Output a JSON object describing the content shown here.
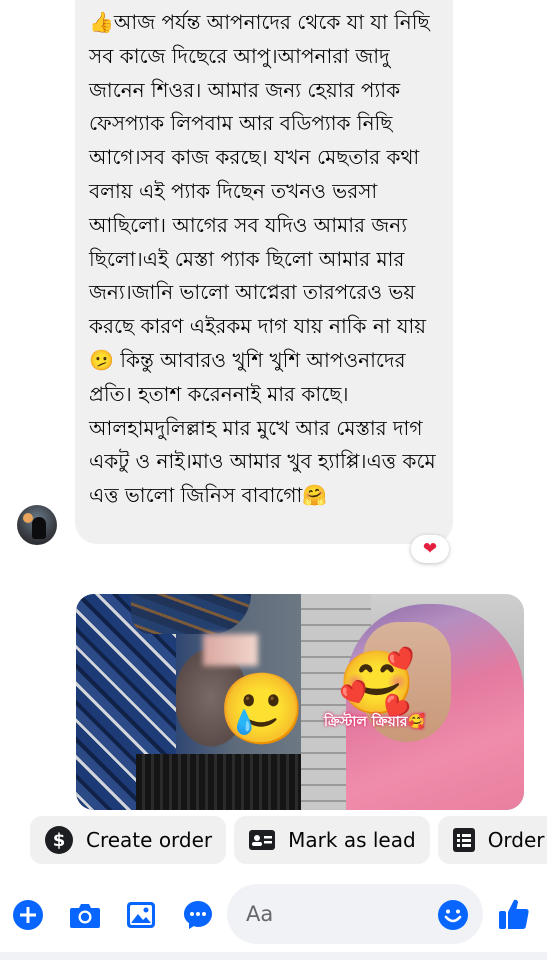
{
  "message": {
    "text": "👍আজ পর্যন্ত আপনাদের থেকে যা যা নিছি সব কাজে দিছেরে আপু।আপনারা জাদু জানেন শিওর। আমার জন্য হেয়ার প্যাক ফেসপ্যাক লিপবাম আর বডিপ্যাক নিছি আগে।সব কাজ করছে। যখন মেছতার কথা বলায় এই প্যাক দিছেন তখনও ভরসা আছিলো। আগের সব যদিও আমার জন্য ছিলো।এই মেস্তা প্যাক ছিলো আমার মার জন্য।জানি ভালো আপ্নেরা তারপরেও ভয় করছে কারণ এইরকম দাগ যায় নাকি না যায় 🫤 কিন্তু আবারও খুশি খুশি আপওনাদের প্রতি। হতাশ করেননাই মার কাছে। আলহামদুলিল্লাহ মার মুখে আর মেস্তার দাগ একটু ও নাই।মাও আমার খুব হ্যাপ্পি।এত্ত কমে এত্ত ভালো জিনিস বাবাগো🤗",
    "reaction": "❤"
  },
  "media": {
    "left_sticker": "🥲",
    "right_sticker": "🥰",
    "overlay_label": "ক্রিস্টাল ক্রিয়ার🥰"
  },
  "actions": [
    {
      "label": "Create order",
      "icon": "dollar-icon"
    },
    {
      "label": "Mark as lead",
      "icon": "contact-card-icon"
    },
    {
      "label": "Order",
      "icon": "list-icon"
    }
  ],
  "composer": {
    "placeholder": "Aa",
    "icons": [
      "plus-icon",
      "camera-icon",
      "gallery-icon",
      "chat-icon",
      "emoji-icon",
      "like-icon"
    ]
  },
  "colors": {
    "accent": "#0866ff",
    "bubble": "#f0f0f0",
    "reaction": "#e41e3f"
  }
}
